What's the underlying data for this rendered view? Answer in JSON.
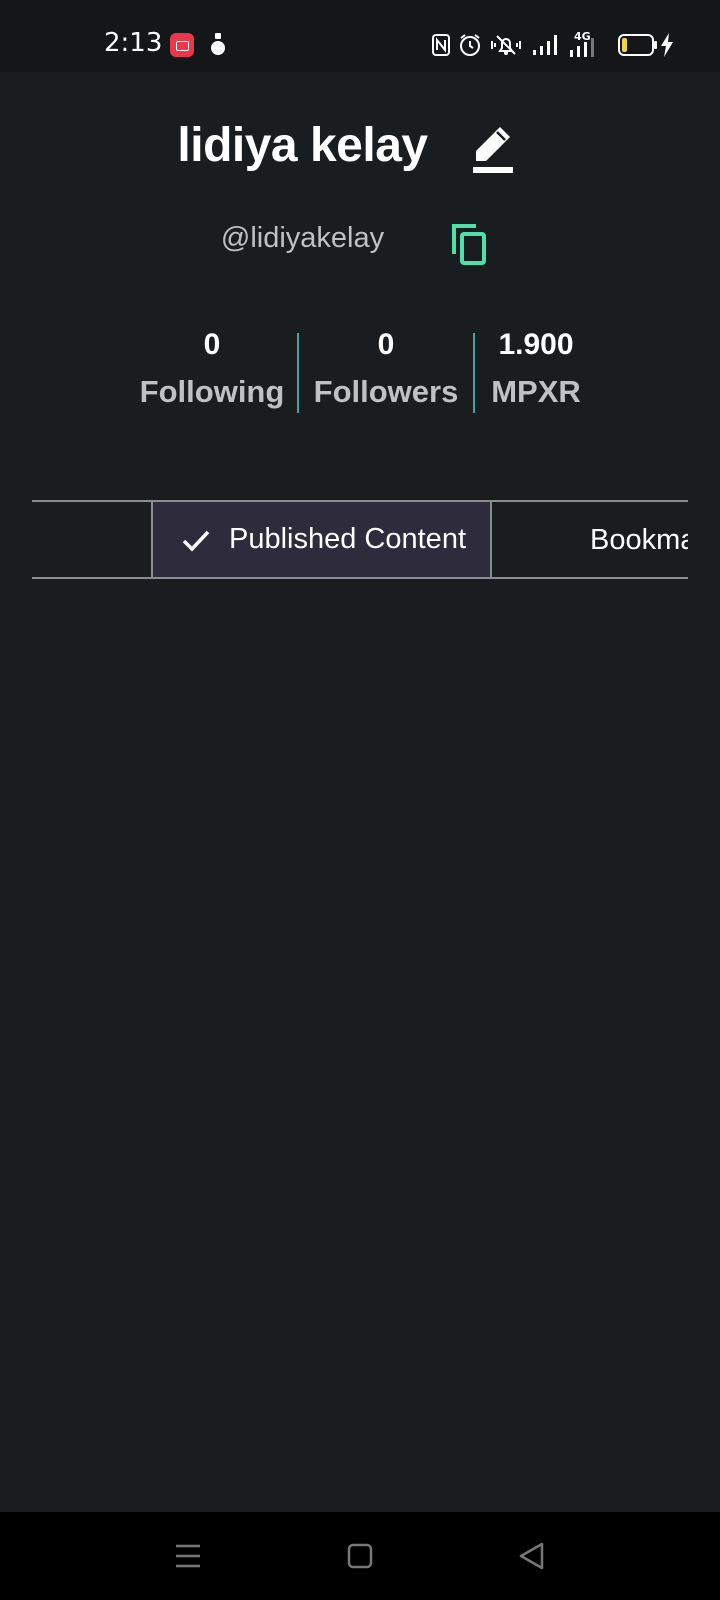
{
  "status_bar": {
    "time": "2:13",
    "network_label": "4G",
    "icons": [
      "screen-record-icon",
      "drop-icon",
      "nfc-icon",
      "alarm-icon",
      "mute-icon",
      "signal-icon",
      "network-4g-icon",
      "battery-icon",
      "charging-icon"
    ],
    "record_color": "#e8384a",
    "battery_level_color": "#f2d24a"
  },
  "profile": {
    "name": "lidiya kelay",
    "handle": "@lidiyakelay",
    "edit_icon": "pencil-edit-icon",
    "copy_icon": "copy-icon",
    "copy_icon_color": "#4fe0a9"
  },
  "stats": [
    {
      "value": "0",
      "label": "Following"
    },
    {
      "value": "0",
      "label": "Followers"
    },
    {
      "value": "1.900",
      "label": "MPXR"
    }
  ],
  "stats_divider_color": "#4aa39a",
  "tabs": {
    "active": {
      "label": "Published Content",
      "icon": "check-icon"
    },
    "next": {
      "label": "Bookmarks"
    }
  },
  "nav_bar": {
    "icons": [
      "menu-icon",
      "home-icon",
      "back-icon"
    ]
  },
  "colors": {
    "background": "#1a1d1f",
    "active_tab_bg": "#2e2b3c"
  }
}
